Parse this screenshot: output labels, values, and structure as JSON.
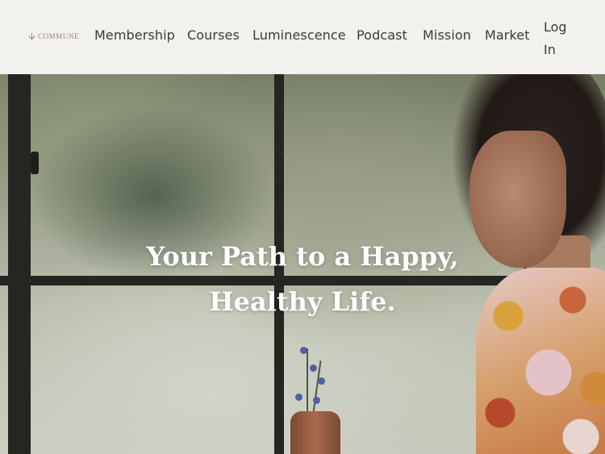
{
  "header": {
    "logo_text": "COMMUNE",
    "nav": [
      {
        "label": "Membership"
      },
      {
        "label": "Courses"
      },
      {
        "label": "Luminescence"
      },
      {
        "label": "Podcast"
      },
      {
        "label": "Mission"
      },
      {
        "label": "Market"
      }
    ],
    "login_label": "Log In"
  },
  "hero": {
    "headline_line1": "Your Path to a Happy,",
    "headline_line2": "Healthy Life."
  },
  "colors": {
    "header_bg": "#f3f1ed",
    "nav_text": "#3b3a38",
    "headline_text": "#ffffff"
  },
  "icons": [
    "commune-logo-mark"
  ]
}
